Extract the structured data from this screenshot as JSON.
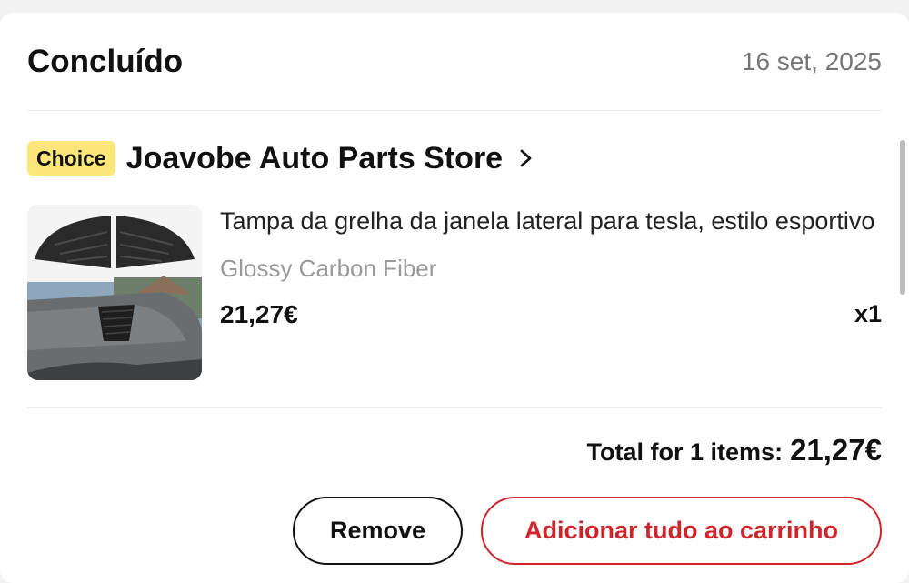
{
  "order": {
    "status": "Concluído",
    "date": "16 set, 2025"
  },
  "store": {
    "badge": "Choice",
    "name": "Joavobe Auto Parts Store",
    "chevron_icon": "chevron-right-icon"
  },
  "item": {
    "title": "Tampa da grelha da janela lateral para tesla, estilo esportivo",
    "variant": "Glossy Carbon Fiber",
    "price": "21,27€",
    "quantity": "x1",
    "image_icon": "product-image"
  },
  "summary": {
    "total_label": "Total for 1 items:",
    "total_value": "21,27€"
  },
  "actions": {
    "remove_label": "Remove",
    "add_all_label": "Adicionar tudo ao carrinho"
  },
  "colors": {
    "badge_bg": "#fde77a",
    "accent_red": "#d0242b",
    "muted_text": "#999999"
  }
}
